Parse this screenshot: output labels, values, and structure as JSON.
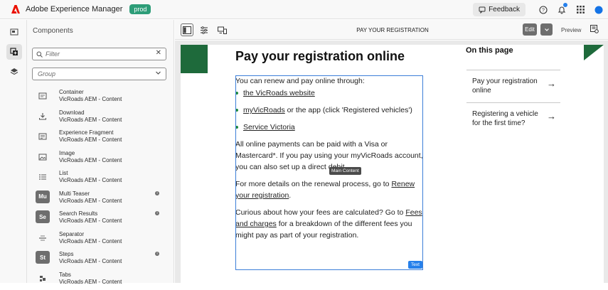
{
  "app": {
    "title": "Adobe Experience Manager",
    "env_badge": "prod",
    "feedback_label": "Feedback"
  },
  "colors": {
    "accent": "#2680eb",
    "brand_red": "#eb1000",
    "env_green": "#2d9d78",
    "page_green": "#1e6a3b"
  },
  "panel": {
    "title": "Components",
    "filter_placeholder": "Filter",
    "group_placeholder": "Group",
    "items": [
      {
        "name": "Container",
        "group": "VicRoads AEM - Content",
        "icon": "container-icon"
      },
      {
        "name": "Download",
        "group": "VicRoads AEM - Content",
        "icon": "download-icon"
      },
      {
        "name": "Experience Fragment",
        "group": "VicRoads AEM - Content",
        "icon": "fragment-icon"
      },
      {
        "name": "Image",
        "group": "VicRoads AEM - Content",
        "icon": "image-icon"
      },
      {
        "name": "List",
        "group": "VicRoads AEM - Content",
        "icon": "list-icon"
      },
      {
        "name": "Multi Teaser",
        "group": "VicRoads AEM - Content",
        "abbr": "Mu"
      },
      {
        "name": "Search Results",
        "group": "VicRoads AEM - Content",
        "abbr": "Se"
      },
      {
        "name": "Separator",
        "group": "VicRoads AEM - Content",
        "icon": "separator-icon"
      },
      {
        "name": "Steps",
        "group": "VicRoads AEM - Content",
        "abbr": "St"
      },
      {
        "name": "Tabs",
        "group": "VicRoads AEM - Content",
        "icon": "tabs-icon"
      }
    ]
  },
  "editor": {
    "page_name": "PAY YOUR REGISTRATION",
    "edit_label": "Edit",
    "preview_label": "Preview"
  },
  "page": {
    "heading": "Pay your registration online",
    "intro": "You can renew and pay online through:",
    "links": [
      "the VicRoads website",
      "myVicRoads",
      "Service Victoria"
    ],
    "myvicroads_suffix": " or the app (click 'Registered vehicles')",
    "para1": "All online payments can be paid with a Visa or Mastercard*. If you pay using your myVicRoads account, you can also set up a direct debit.",
    "para2_prefix": "For more details on the renewal process, go to ",
    "para2_link": "Renew your registration",
    "para2_suffix": ".",
    "para3_prefix": "Curious about how your fees are calculated? Go to ",
    "para3_link": "Fees and charges",
    "para3_suffix": " for a breakdown of the different fees you might pay as part of your registration.",
    "tooltip": "Main Content",
    "text_tag": "Text"
  },
  "toc": {
    "heading": "On this page",
    "items": [
      "Pay your registration online",
      "Registering a vehicle for the first time?"
    ]
  }
}
